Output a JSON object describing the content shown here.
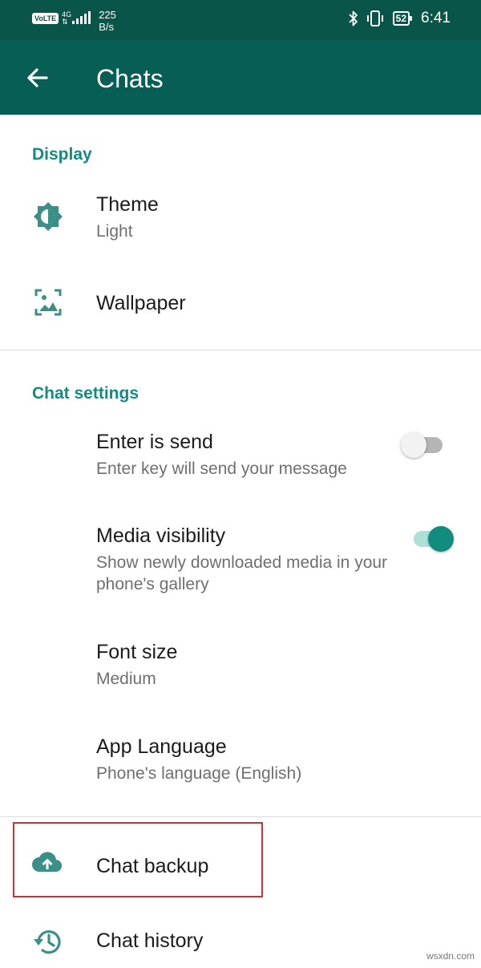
{
  "status_bar": {
    "volte": "VoLTE",
    "network": "4G",
    "speed_value": "225",
    "speed_unit": "B/s",
    "battery": "52",
    "time": "6:41"
  },
  "app_bar": {
    "back_icon": "arrow-left-icon",
    "title": "Chats"
  },
  "display": {
    "section_title": "Display",
    "theme": {
      "label": "Theme",
      "value": "Light",
      "icon": "brightness-icon"
    },
    "wallpaper": {
      "label": "Wallpaper",
      "icon": "wallpaper-icon"
    }
  },
  "chat_settings": {
    "section_title": "Chat settings",
    "enter_is_send": {
      "label": "Enter is send",
      "description": "Enter key will send your message",
      "enabled": false
    },
    "media_visibility": {
      "label": "Media visibility",
      "description": "Show newly downloaded media in your phone's gallery",
      "enabled": true
    },
    "font_size": {
      "label": "Font size",
      "value": "Medium"
    },
    "app_language": {
      "label": "App Language",
      "value": "Phone's language (English)"
    }
  },
  "more": {
    "chat_backup": {
      "label": "Chat backup",
      "icon": "cloud-upload-icon"
    },
    "chat_history": {
      "label": "Chat history",
      "icon": "history-icon"
    }
  },
  "watermark": "wsxdn.com",
  "colors": {
    "status_bar": "#0a5549",
    "app_bar": "#075e54",
    "accent": "#128c7e",
    "highlight_box": "#d32f2f"
  }
}
